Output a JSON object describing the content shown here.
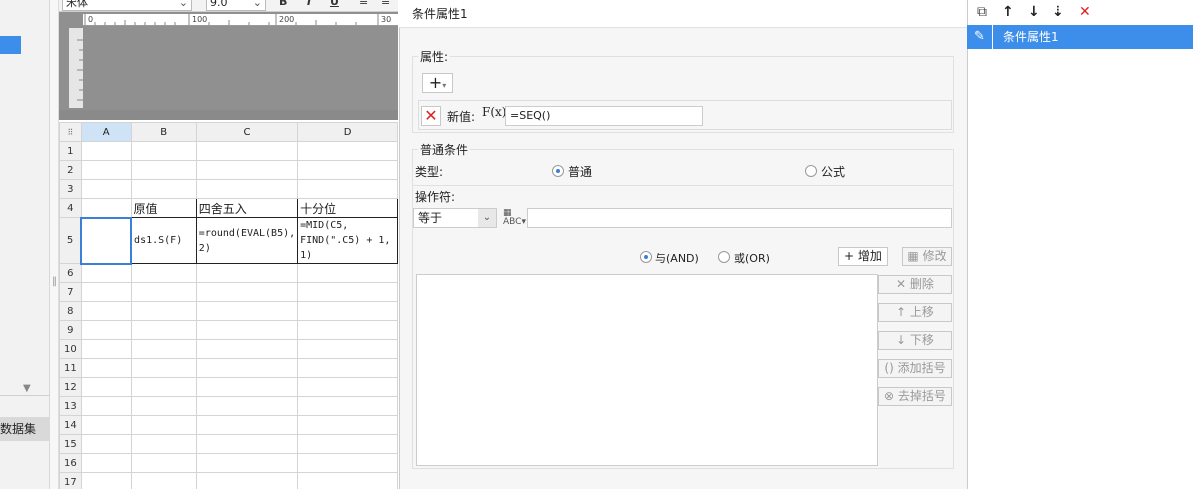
{
  "left": {
    "dataset_label": "数据集"
  },
  "toolbar": {
    "font_name": "宋体",
    "font_size": "9.0",
    "bold": "B",
    "italic": "I",
    "underline": "U"
  },
  "ruler": {
    "ticks": [
      "0",
      "100",
      "200",
      "30"
    ]
  },
  "sheet": {
    "col_headers": [
      "A",
      "B",
      "C",
      "D"
    ],
    "rows": [
      {
        "n": "1",
        "cells": [
          "",
          "",
          "",
          ""
        ]
      },
      {
        "n": "2",
        "cells": [
          "",
          "",
          "",
          ""
        ]
      },
      {
        "n": "3",
        "cells": [
          "",
          "",
          "",
          ""
        ]
      },
      {
        "n": "4",
        "cells": [
          "",
          "原值",
          "四舍五入",
          "十分位"
        ]
      },
      {
        "n": "5",
        "cells": [
          "",
          "ds1.S(F)",
          "=round(EVAL(B5), 2)",
          "=MID(C5, FIND(\".C5) + 1, 1)"
        ]
      },
      {
        "n": "6"
      },
      {
        "n": "7"
      },
      {
        "n": "8"
      },
      {
        "n": "9"
      },
      {
        "n": "10"
      },
      {
        "n": "11"
      },
      {
        "n": "12"
      },
      {
        "n": "13"
      },
      {
        "n": "14"
      },
      {
        "n": "15"
      },
      {
        "n": "16"
      },
      {
        "n": "17"
      }
    ]
  },
  "dialog": {
    "title": "条件属性1",
    "attr_group_label": "属性:",
    "new_value_label": "新值:",
    "fx_label": "F(x)",
    "new_value": "=SEQ()",
    "condition_group_label": "普通条件",
    "type_label": "类型:",
    "type_normal": "普通",
    "type_formula": "公式",
    "operator_label": "操作符:",
    "operator_value": "等于",
    "and_label": "与(AND)",
    "or_label": "或(OR)",
    "add_btn": "增加",
    "modify_btn": "修改",
    "delete_btn": "删除",
    "up_btn": "上移",
    "down_btn": "下移",
    "add_paren_btn": "添加括号",
    "remove_paren_btn": "去掉括号"
  },
  "right": {
    "item_label": "条件属性1"
  },
  "colors": {
    "accent": "#3d8eea",
    "delete_red": "#e02020"
  }
}
